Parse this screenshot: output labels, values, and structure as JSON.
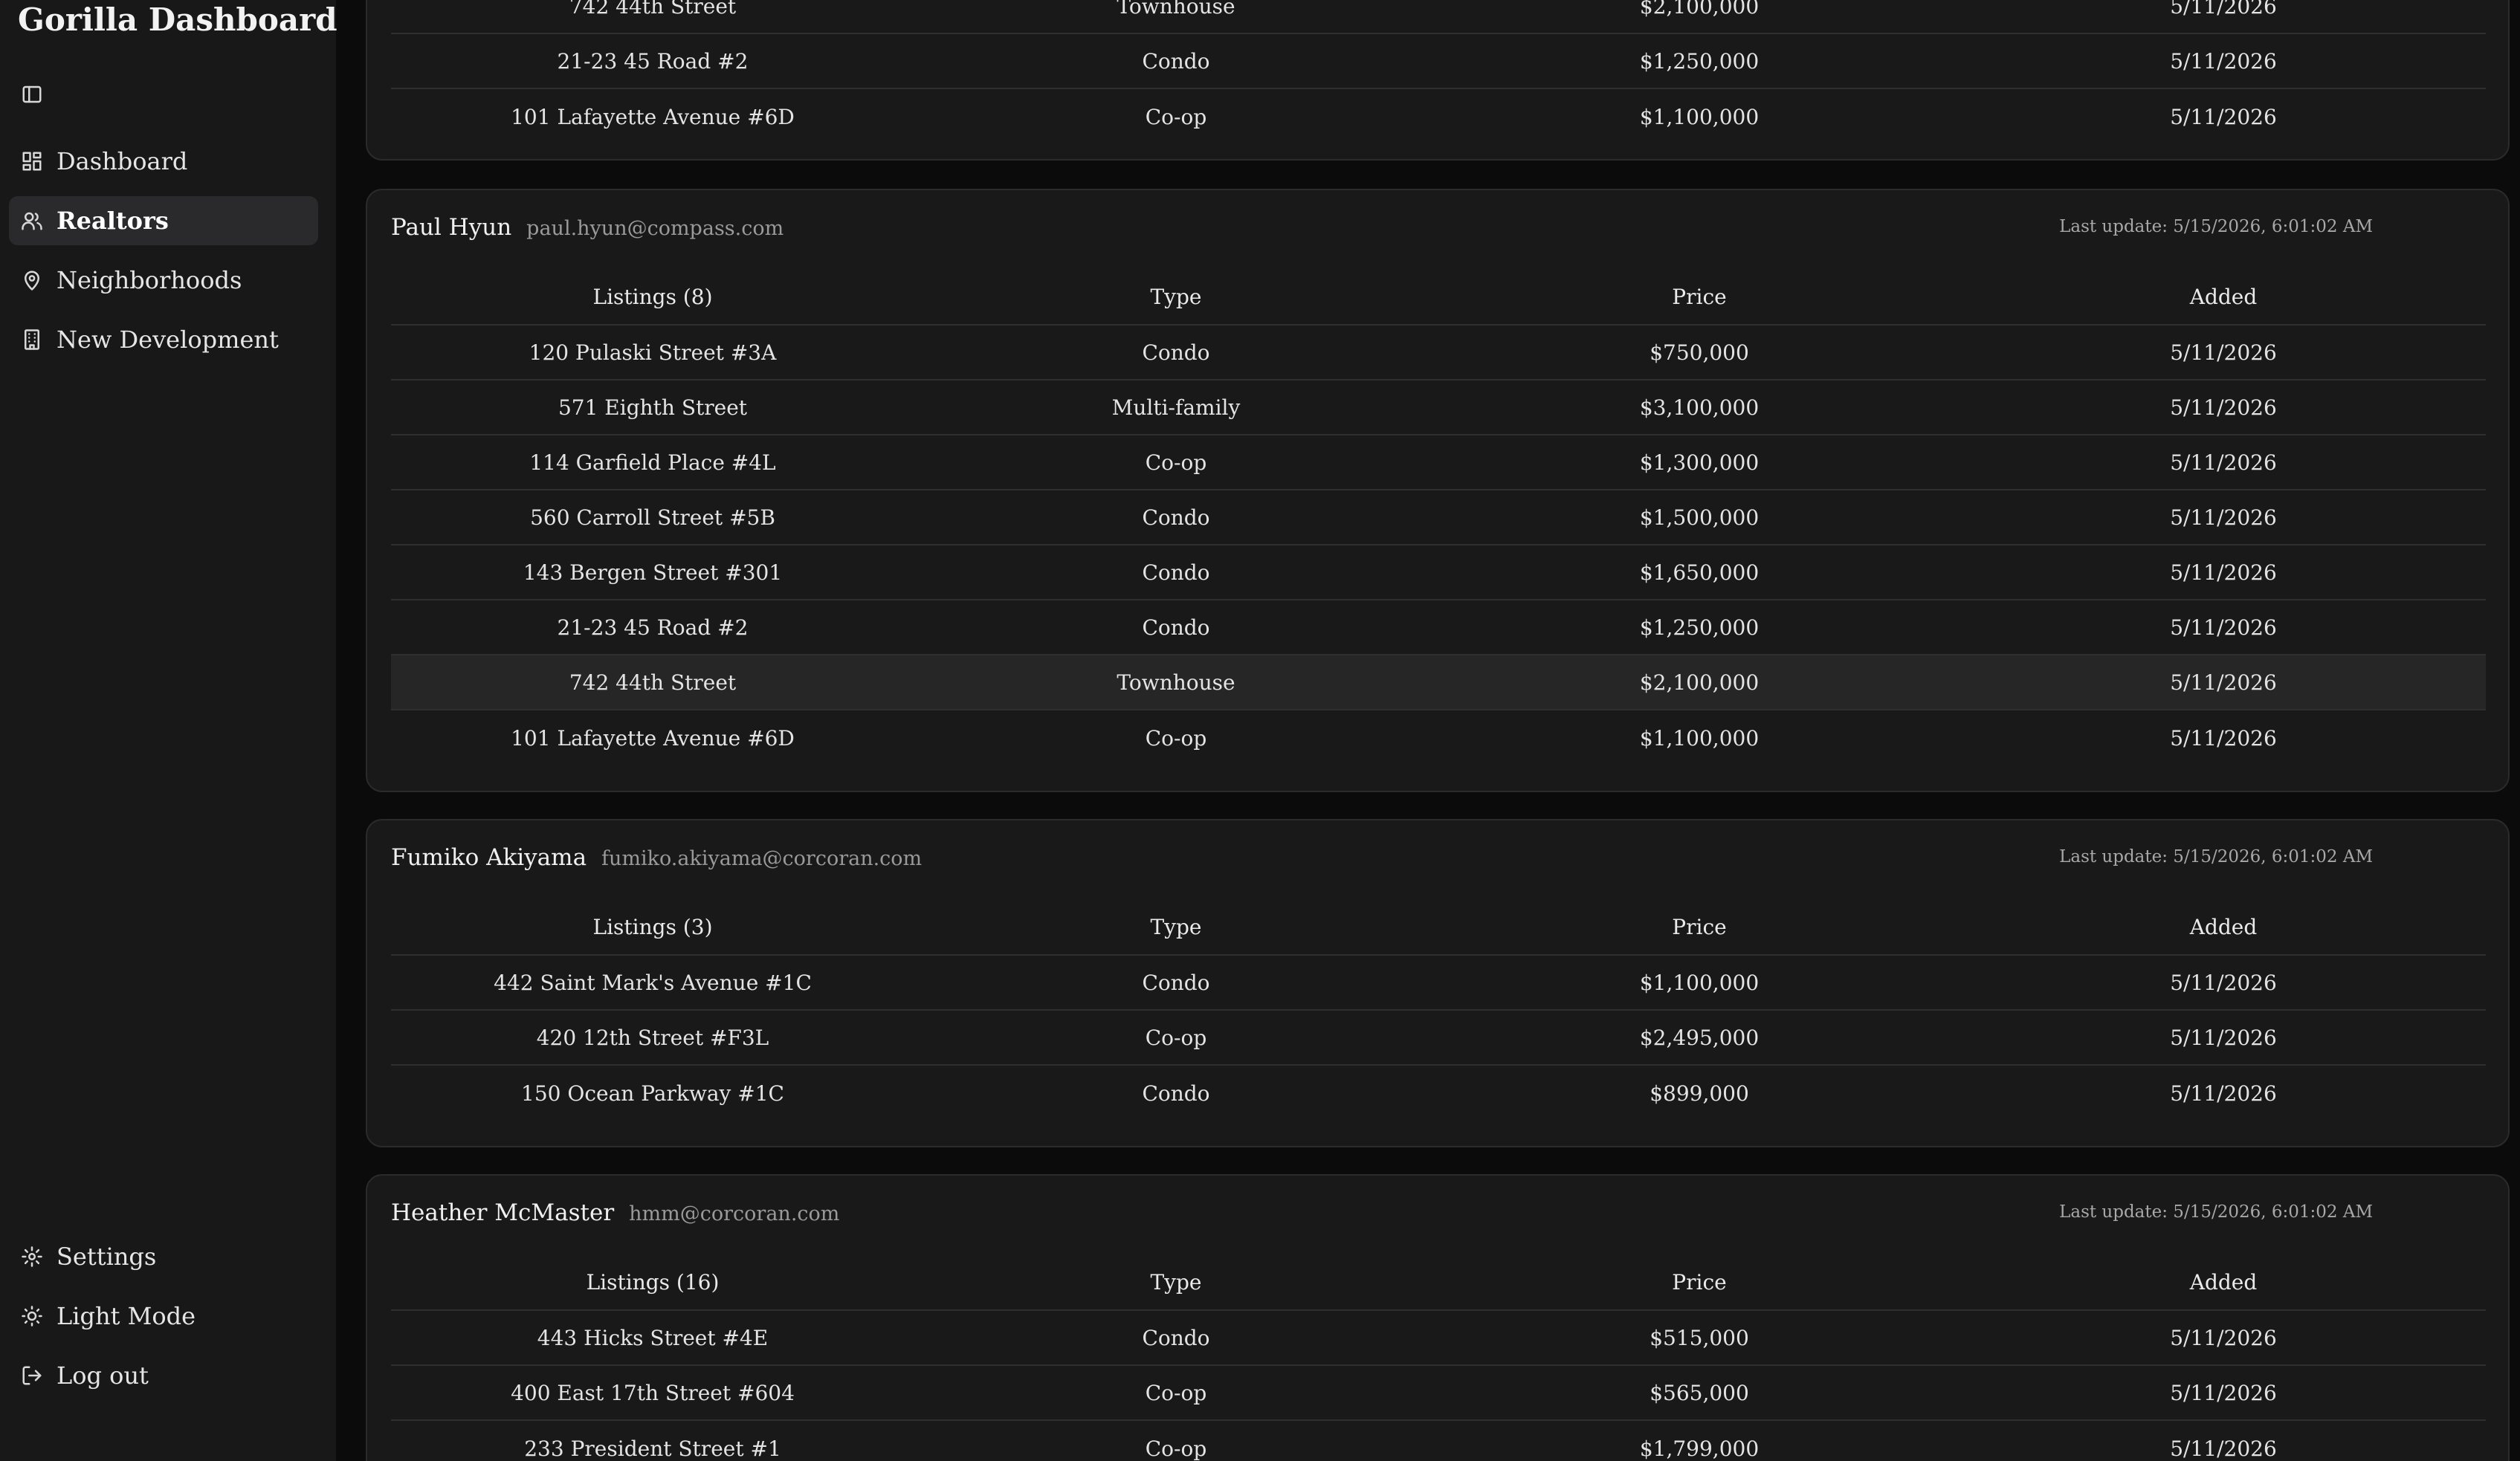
{
  "app": {
    "title": "Gorilla Dashboard"
  },
  "sidebar": {
    "toggle_icon": "sidebar-toggle-icon",
    "nav": [
      {
        "label": "Dashboard",
        "icon": "dashboard-icon",
        "active": false
      },
      {
        "label": "Realtors",
        "icon": "users-icon",
        "active": true
      },
      {
        "label": "Neighborhoods",
        "icon": "map-pin-icon",
        "active": false
      },
      {
        "label": "New Development",
        "icon": "building-icon",
        "active": false
      }
    ],
    "bottom": [
      {
        "label": "Settings",
        "icon": "gear-icon"
      },
      {
        "label": "Light Mode",
        "icon": "sun-icon"
      },
      {
        "label": "Log out",
        "icon": "logout-icon"
      }
    ]
  },
  "columns": {
    "type": "Type",
    "price": "Price",
    "added": "Added"
  },
  "cards": [
    {
      "name": "",
      "email": "",
      "last_update": "",
      "listings_header": "",
      "rows": [
        {
          "address": "742 44th Street",
          "type": "Townhouse",
          "price": "$2,100,000",
          "added": "5/11/2026"
        },
        {
          "address": "21-23 45 Road #2",
          "type": "Condo",
          "price": "$1,250,000",
          "added": "5/11/2026"
        },
        {
          "address": "101 Lafayette Avenue #6D",
          "type": "Co-op",
          "price": "$1,100,000",
          "added": "5/11/2026"
        }
      ]
    },
    {
      "name": "Paul Hyun",
      "email": "paul.hyun@compass.com",
      "last_update": "Last update: 5/15/2026, 6:01:02 AM",
      "listings_header": "Listings (8)",
      "rows": [
        {
          "address": "120 Pulaski Street #3A",
          "type": "Condo",
          "price": "$750,000",
          "added": "5/11/2026"
        },
        {
          "address": "571 Eighth Street",
          "type": "Multi-family",
          "price": "$3,100,000",
          "added": "5/11/2026"
        },
        {
          "address": "114 Garfield Place #4L",
          "type": "Co-op",
          "price": "$1,300,000",
          "added": "5/11/2026"
        },
        {
          "address": "560 Carroll Street #5B",
          "type": "Condo",
          "price": "$1,500,000",
          "added": "5/11/2026"
        },
        {
          "address": "143 Bergen Street #301",
          "type": "Condo",
          "price": "$1,650,000",
          "added": "5/11/2026"
        },
        {
          "address": "21-23 45 Road #2",
          "type": "Condo",
          "price": "$1,250,000",
          "added": "5/11/2026"
        },
        {
          "address": "742 44th Street",
          "type": "Townhouse",
          "price": "$2,100,000",
          "added": "5/11/2026"
        },
        {
          "address": "101 Lafayette Avenue #6D",
          "type": "Co-op",
          "price": "$1,100,000",
          "added": "5/11/2026"
        }
      ]
    },
    {
      "name": "Fumiko Akiyama",
      "email": "fumiko.akiyama@corcoran.com",
      "last_update": "Last update: 5/15/2026, 6:01:02 AM",
      "listings_header": "Listings (3)",
      "rows": [
        {
          "address": "442 Saint Mark's Avenue #1C",
          "type": "Condo",
          "price": "$1,100,000",
          "added": "5/11/2026"
        },
        {
          "address": "420 12th Street #F3L",
          "type": "Co-op",
          "price": "$2,495,000",
          "added": "5/11/2026"
        },
        {
          "address": "150 Ocean Parkway #1C",
          "type": "Condo",
          "price": "$899,000",
          "added": "5/11/2026"
        }
      ]
    },
    {
      "name": "Heather McMaster",
      "email": "hmm@corcoran.com",
      "last_update": "Last update: 5/15/2026, 6:01:02 AM",
      "listings_header": "Listings (16)",
      "rows": [
        {
          "address": "443 Hicks Street #4E",
          "type": "Condo",
          "price": "$515,000",
          "added": "5/11/2026"
        },
        {
          "address": "400 East 17th Street #604",
          "type": "Co-op",
          "price": "$565,000",
          "added": "5/11/2026"
        },
        {
          "address": "233 President Street #1",
          "type": "Co-op",
          "price": "$1,799,000",
          "added": "5/11/2026"
        }
      ]
    }
  ]
}
